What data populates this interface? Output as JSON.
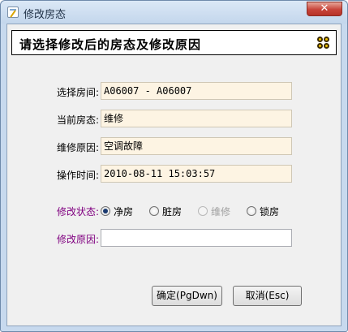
{
  "window": {
    "title": "修改房态",
    "close_glyph": "✕"
  },
  "header": {
    "title": "请选择修改后的房态及修改原因"
  },
  "form": {
    "room": {
      "label": "选择房间:",
      "value": "A06007 - A06007"
    },
    "current_status": {
      "label": "当前房态:",
      "value": "维修"
    },
    "repair_reason": {
      "label": "维修原因:",
      "value": "空调故障"
    },
    "operation_time": {
      "label": "操作时间:",
      "value": "2010-08-11 15:03:57"
    },
    "modify_status": {
      "label": "修改状态:",
      "options": [
        {
          "label": "净房",
          "checked": true,
          "disabled": false
        },
        {
          "label": "脏房",
          "checked": false,
          "disabled": false
        },
        {
          "label": "维修",
          "checked": false,
          "disabled": true
        },
        {
          "label": "锁房",
          "checked": false,
          "disabled": false
        }
      ]
    },
    "modify_reason": {
      "label": "修改原因:",
      "value": ""
    }
  },
  "buttons": {
    "ok": "确定(PgDwn)",
    "cancel": "取消(Esc)"
  },
  "colors": {
    "purple_label": "#800080",
    "field_bg": "#fdf4e3",
    "icon_gold": "#f2c300"
  }
}
